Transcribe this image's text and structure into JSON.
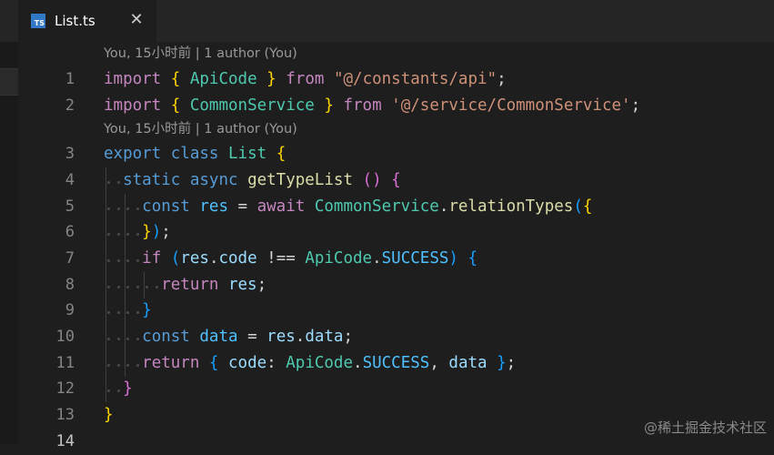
{
  "tab": {
    "icon_label": "TS",
    "file_name": "List.ts",
    "close_glyph": "✕"
  },
  "codelens": [
    {
      "text": "You, 15小时前 | 1 author (You)"
    },
    {
      "text": "You, 15小时前 | 1 author (You)"
    }
  ],
  "lines": [
    {
      "num": "1",
      "tokens": [
        [
          "k",
          "import"
        ],
        [
          "p",
          " "
        ],
        [
          "b1",
          "{"
        ],
        [
          "p",
          " "
        ],
        [
          "ty",
          "ApiCode"
        ],
        [
          "p",
          " "
        ],
        [
          "b1",
          "}"
        ],
        [
          "p",
          " "
        ],
        [
          "k",
          "from"
        ],
        [
          "p",
          " "
        ],
        [
          "s",
          "\"@/constants/api\""
        ],
        [
          "p",
          ";"
        ]
      ]
    },
    {
      "num": "2",
      "tokens": [
        [
          "k",
          "import"
        ],
        [
          "p",
          " "
        ],
        [
          "b1",
          "{"
        ],
        [
          "p",
          " "
        ],
        [
          "ty",
          "CommonService"
        ],
        [
          "p",
          " "
        ],
        [
          "b1",
          "}"
        ],
        [
          "p",
          " "
        ],
        [
          "k",
          "from"
        ],
        [
          "p",
          " "
        ],
        [
          "s",
          "'@/service/CommonService'"
        ],
        [
          "p",
          ";"
        ]
      ]
    },
    {
      "num": "3",
      "tokens": [
        [
          "kb",
          "export"
        ],
        [
          "p",
          " "
        ],
        [
          "kb",
          "class"
        ],
        [
          "p",
          " "
        ],
        [
          "ty",
          "List"
        ],
        [
          "p",
          " "
        ],
        [
          "b1",
          "{"
        ]
      ]
    },
    {
      "num": "4",
      "tokens": [
        [
          "p",
          "  "
        ],
        [
          "kb",
          "static"
        ],
        [
          "p",
          " "
        ],
        [
          "kb",
          "async"
        ],
        [
          "p",
          " "
        ],
        [
          "fn",
          "getTypeList"
        ],
        [
          "p",
          " "
        ],
        [
          "b2",
          "()"
        ],
        [
          "p",
          " "
        ],
        [
          "b2",
          "{"
        ]
      ]
    },
    {
      "num": "5",
      "tokens": [
        [
          "p",
          "    "
        ],
        [
          "kb",
          "const"
        ],
        [
          "p",
          " "
        ],
        [
          "c",
          "res"
        ],
        [
          "p",
          " = "
        ],
        [
          "k",
          "await"
        ],
        [
          "p",
          " "
        ],
        [
          "ty",
          "CommonService"
        ],
        [
          "p",
          "."
        ],
        [
          "fn",
          "relationTypes"
        ],
        [
          "b3",
          "("
        ],
        [
          "b1",
          "{"
        ]
      ]
    },
    {
      "num": "6",
      "tokens": [
        [
          "p",
          "    "
        ],
        [
          "b1",
          "}"
        ],
        [
          "b3",
          ")"
        ],
        [
          "p",
          ";"
        ]
      ]
    },
    {
      "num": "7",
      "tokens": [
        [
          "p",
          "    "
        ],
        [
          "k",
          "if"
        ],
        [
          "p",
          " "
        ],
        [
          "b3",
          "("
        ],
        [
          "v",
          "res"
        ],
        [
          "p",
          "."
        ],
        [
          "v",
          "code"
        ],
        [
          "p",
          " !== "
        ],
        [
          "ty",
          "ApiCode"
        ],
        [
          "p",
          "."
        ],
        [
          "c",
          "SUCCESS"
        ],
        [
          "b3",
          ")"
        ],
        [
          "p",
          " "
        ],
        [
          "b3",
          "{"
        ]
      ]
    },
    {
      "num": "8",
      "tokens": [
        [
          "p",
          "      "
        ],
        [
          "k",
          "return"
        ],
        [
          "p",
          " "
        ],
        [
          "v",
          "res"
        ],
        [
          "p",
          ";"
        ]
      ]
    },
    {
      "num": "9",
      "tokens": [
        [
          "p",
          "    "
        ],
        [
          "b3",
          "}"
        ]
      ]
    },
    {
      "num": "10",
      "tokens": [
        [
          "p",
          "    "
        ],
        [
          "kb",
          "const"
        ],
        [
          "p",
          " "
        ],
        [
          "c",
          "data"
        ],
        [
          "p",
          " = "
        ],
        [
          "v",
          "res"
        ],
        [
          "p",
          "."
        ],
        [
          "v",
          "data"
        ],
        [
          "p",
          ";"
        ]
      ]
    },
    {
      "num": "11",
      "tokens": [
        [
          "p",
          "    "
        ],
        [
          "k",
          "return"
        ],
        [
          "p",
          " "
        ],
        [
          "b3",
          "{"
        ],
        [
          "p",
          " "
        ],
        [
          "v",
          "code"
        ],
        [
          "p",
          ": "
        ],
        [
          "ty",
          "ApiCode"
        ],
        [
          "p",
          "."
        ],
        [
          "c",
          "SUCCESS"
        ],
        [
          "p",
          ", "
        ],
        [
          "v",
          "data"
        ],
        [
          "p",
          " "
        ],
        [
          "b3",
          "}"
        ],
        [
          "p",
          ";"
        ]
      ]
    },
    {
      "num": "12",
      "tokens": [
        [
          "p",
          "  "
        ],
        [
          "b2",
          "}"
        ]
      ]
    },
    {
      "num": "13",
      "tokens": [
        [
          "b1",
          "}"
        ]
      ]
    },
    {
      "num": "14",
      "tokens": []
    }
  ],
  "watermark": "@稀土掘金技术社区"
}
